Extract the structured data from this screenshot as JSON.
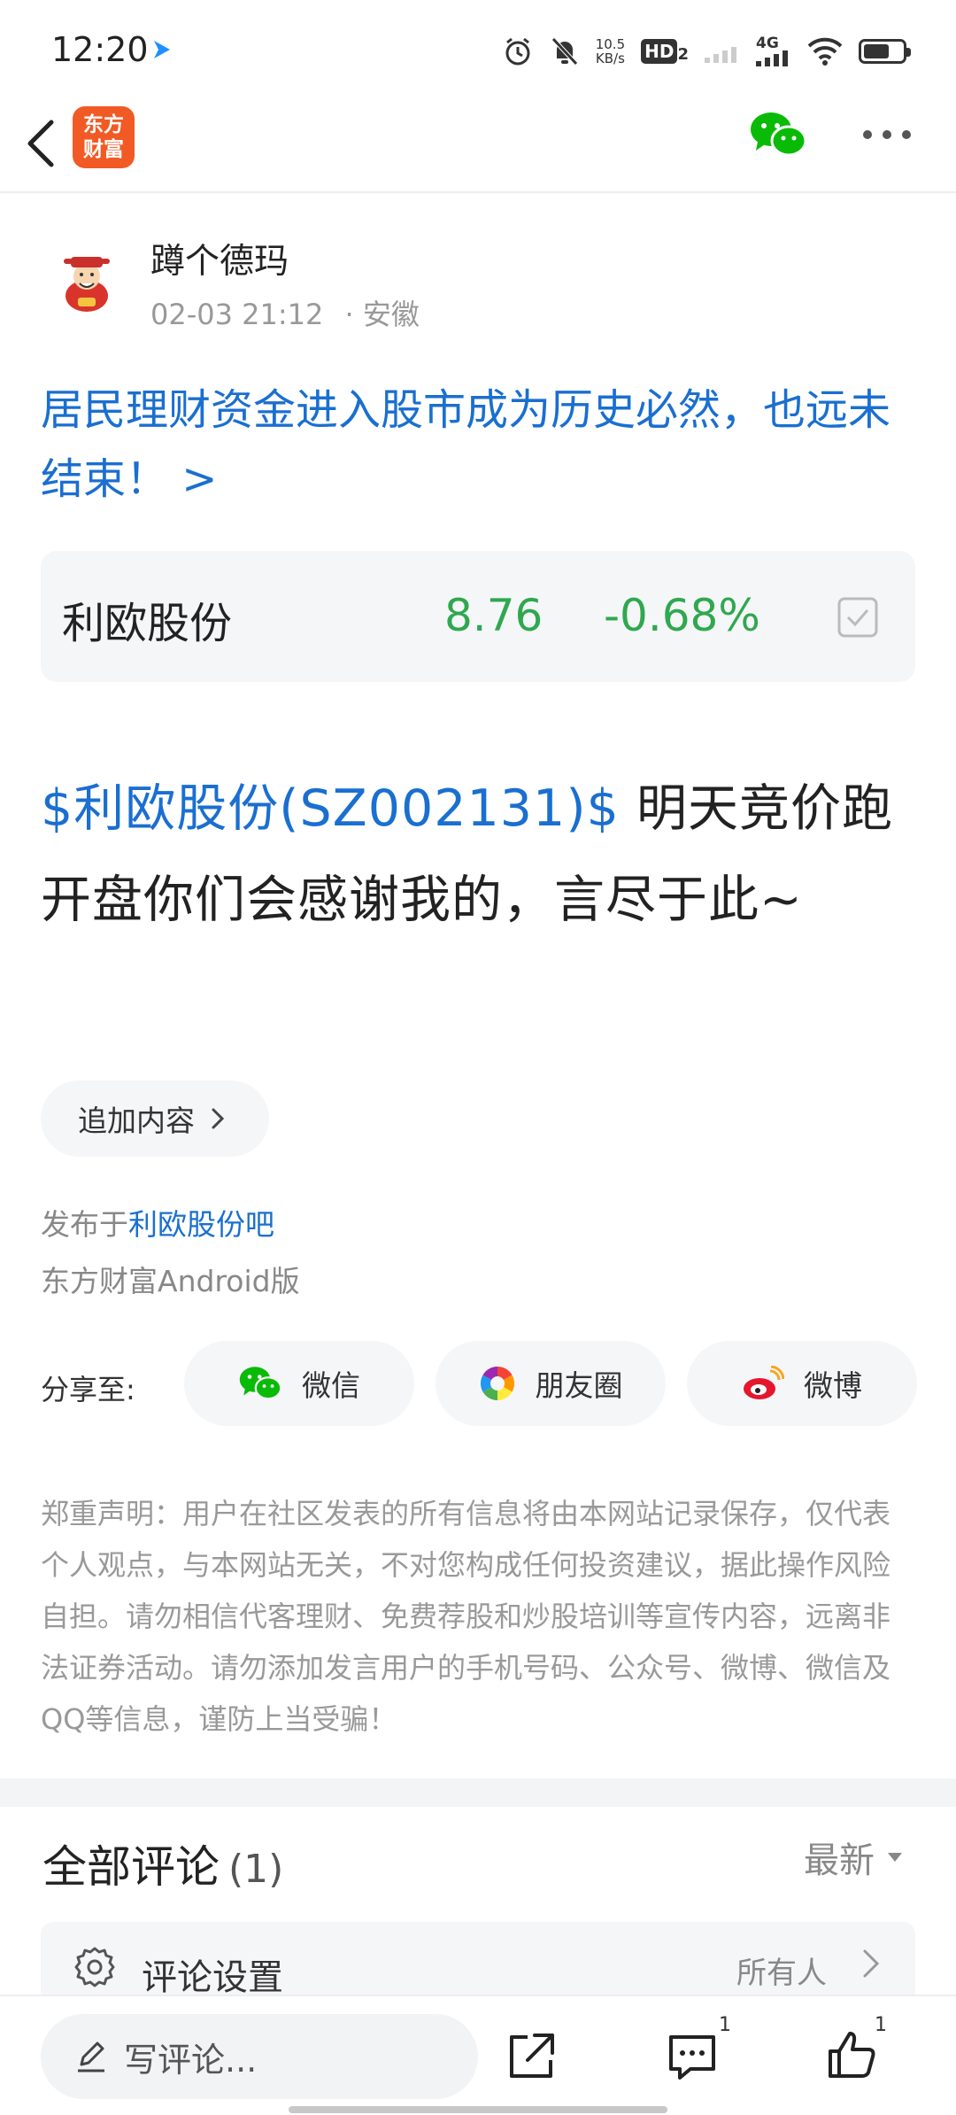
{
  "status_bar": {
    "time": "12:20",
    "net_speed_value": "10.5",
    "net_speed_unit": "KB/s",
    "hd_label": "HD",
    "hd_sub": "2",
    "network": "4G"
  },
  "nav": {
    "logo_line1": "东方",
    "logo_line2": "财富"
  },
  "post": {
    "author": "蹲个德玛",
    "datetime": "02-03 21:12",
    "location": "· 安徽",
    "title": "居民理财资金进入股市成为历史必然，也远未结束！ >",
    "stock": {
      "name": "利欧股份",
      "price": "8.76",
      "change": "-0.68%"
    },
    "body_tag": "$利欧股份(SZ002131)$",
    "body_text": " 明天竞价跑 开盘你们会感谢我的，言尽于此~",
    "append_label": "追加内容",
    "publish_prefix": "发布于",
    "publish_bar": "利欧股份吧",
    "client": "东方财富Android版"
  },
  "share": {
    "label": "分享至:",
    "wechat": "微信",
    "moments": "朋友圈",
    "weibo": "微博"
  },
  "disclaimer": "郑重声明：用户在社区发表的所有信息将由本网站记录保存，仅代表个人观点，与本网站无关，不对您构成任何投资建议，据此操作风险自担。请勿相信代客理财、免费荐股和炒股培训等宣传内容，远离非法证券活动。请勿添加发言用户的手机号码、公众号、微博、微信及QQ等信息，谨防上当受骗！",
  "comments": {
    "title": "全部评论",
    "count": "(1)",
    "sort": "最新",
    "settings_label": "评论设置",
    "settings_value": "所有人"
  },
  "bottom_bar": {
    "input_placeholder": "写评论...",
    "comment_count": "1",
    "like_count": "1"
  },
  "colors": {
    "link_blue": "#1a6fd0",
    "stock_green": "#2fa84f",
    "brand_orange": "#f15a24",
    "wechat_green": "#09bb07"
  }
}
